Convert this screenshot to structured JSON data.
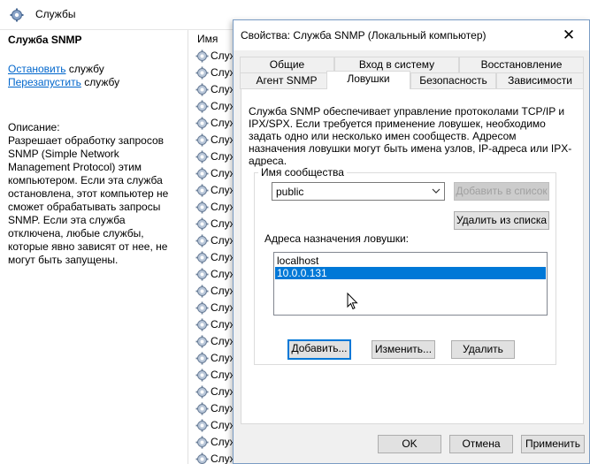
{
  "services_window": {
    "title": "Службы",
    "selected_service": "Служба SNMP",
    "stop_link": "Остановить",
    "stop_suffix": " службу",
    "restart_link": "Перезапустить",
    "restart_suffix": " службу",
    "description_label": "Описание:",
    "description": "Разрешает обработку запросов SNMP (Simple Network Management Protocol) этим компьютером. Если эта служба остановлена, этот компьютер не сможет обрабатывать запросы SNMP. Если эта служба отключена, любые службы, которые явно зависят от нее, не могут быть запущены.",
    "column_name": "Имя",
    "row_prefix": "Служ"
  },
  "dialog": {
    "title": "Свойства: Служба SNMP (Локальный компьютер)",
    "tabs_row1": [
      "Общие",
      "Вход в систему",
      "Восстановление"
    ],
    "tabs_row2": [
      "Агент SNMP",
      "Ловушки",
      "Безопасность",
      "Зависимости"
    ],
    "active_tab": "Ловушки",
    "intro": "Служба SNMP обеспечивает управление протоколами TCP/IP и IPX/SPX. Если требуется применение ловушек, необходимо задать одно или несколько имен сообществ. Адресом назначения ловушки могут быть имена узлов, IP-адреса или IPX-адреса.",
    "community_label": "Имя сообщества",
    "community_value": "public",
    "add_to_list": "Добавить в список",
    "remove_from_list": "Удалить из списка",
    "destinations_label": "Адреса назначения ловушки:",
    "destinations": [
      "localhost",
      "10.0.0.131"
    ],
    "selected_destination": "10.0.0.131",
    "add_button": "Добавить...",
    "edit_button": "Изменить...",
    "delete_button": "Удалить",
    "ok_button": "OK",
    "cancel_button": "Отмена",
    "apply_button": "Применить"
  },
  "colors": {
    "link": "#0066cc",
    "selection": "#0078d7",
    "dialog_bg": "#f0f0f0"
  }
}
